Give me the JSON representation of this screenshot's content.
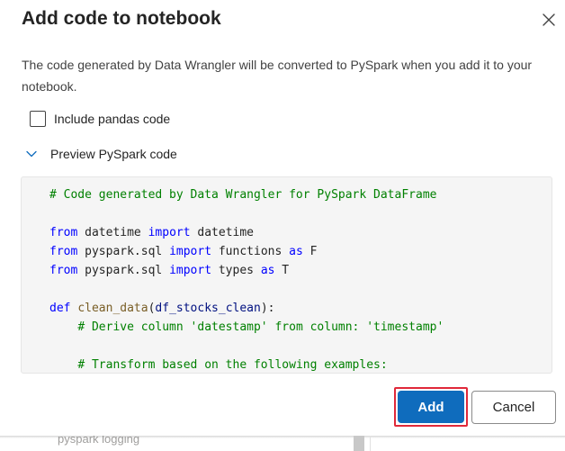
{
  "dialog": {
    "title": "Add code to notebook",
    "description": "The code generated by Data Wrangler will be converted to PySpark when you add it to your notebook.",
    "close_icon": "close-icon",
    "checkbox": {
      "label": "Include pandas code",
      "checked": false
    },
    "preview": {
      "label": "Preview PySpark code",
      "expanded": true,
      "icon": "chevron-down-icon"
    },
    "code_lines": [
      "# Code generated by Data Wrangler for PySpark DataFrame",
      "",
      "from datetime import datetime",
      "from pyspark.sql import functions as F",
      "from pyspark.sql import types as T",
      "",
      "def clean_data(df_stocks_clean):",
      "    # Derive column 'datestamp' from column: 'timestamp'",
      "",
      "    # Transform based on the following examples:"
    ],
    "buttons": {
      "add": "Add",
      "cancel": "Cancel"
    }
  },
  "background": {
    "partial_text": "pyspark logging"
  },
  "colors": {
    "primary": "#0f6cbd",
    "highlight_border": "#e0293a",
    "code_comment": "#008000",
    "code_keyword": "#0000ff",
    "code_background": "#f5f5f5"
  }
}
